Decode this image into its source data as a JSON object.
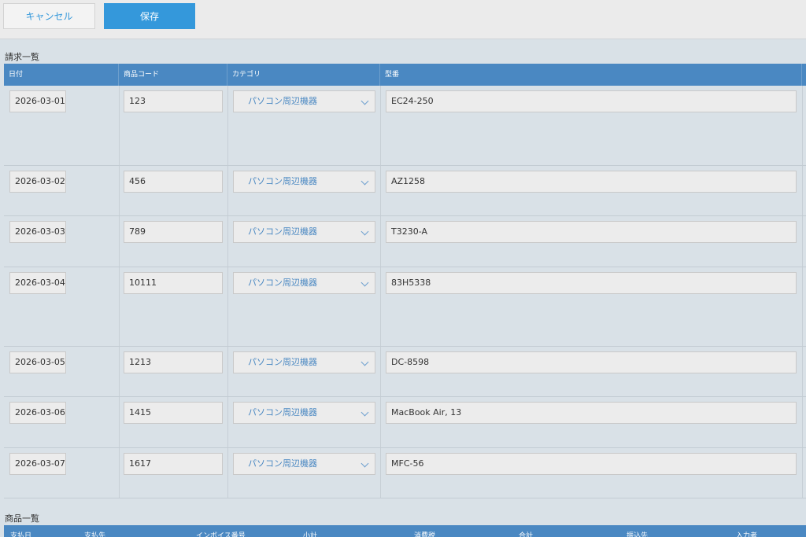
{
  "toolbar": {
    "cancel_label": "キャンセル",
    "save_label": "保存"
  },
  "invoice_list": {
    "title": "請求一覧",
    "columns": [
      "日付",
      "商品コード",
      "カテゴリ",
      "型番"
    ],
    "rows": [
      {
        "date": "2026-03-01",
        "code": "123",
        "category": "パソコン周辺機器",
        "model": "EC24-250"
      },
      {
        "date": "2026-03-02",
        "code": "456",
        "category": "パソコン周辺機器",
        "model": "AZ1258"
      },
      {
        "date": "2026-03-03",
        "code": "789",
        "category": "パソコン周辺機器",
        "model": "T3230-A"
      },
      {
        "date": "2026-03-04",
        "code": "10111",
        "category": "パソコン周辺機器",
        "model": "83H5338"
      },
      {
        "date": "2026-03-05",
        "code": "1213",
        "category": "パソコン周辺機器",
        "model": "DC-8598"
      },
      {
        "date": "2026-03-06",
        "code": "1415",
        "category": "パソコン周辺機器",
        "model": "MacBook Air, 13"
      },
      {
        "date": "2026-03-07",
        "code": "1617",
        "category": "パソコン周辺機器",
        "model": "MFC-56"
      }
    ]
  },
  "product_list": {
    "title": "商品一覧",
    "columns": [
      "支払日",
      "支払先",
      "インボイス番号",
      "小計",
      "消費税",
      "合計",
      "振込先",
      "入力者"
    ]
  },
  "colors": {
    "header": "#4a88c2",
    "accent": "#3498db",
    "background": "#d9e1e7"
  },
  "icons": {
    "dropdown": "chevron-down-icon"
  }
}
